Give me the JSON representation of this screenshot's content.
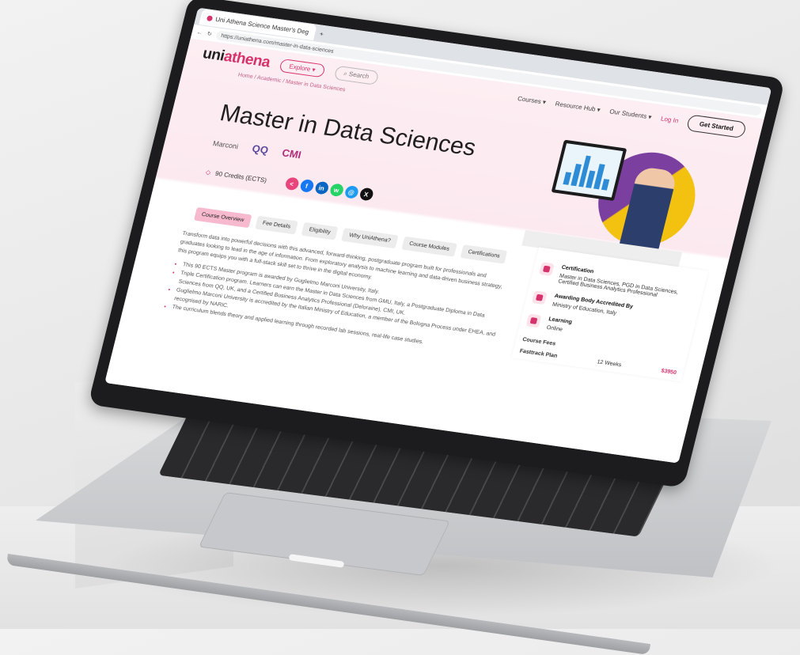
{
  "browser": {
    "tab_title": "Uni Athena Science Master's Deg",
    "url": "https://uniathena.com/master-in-data-sciences"
  },
  "nav": {
    "logo_main": "uni",
    "logo_accent": "athena",
    "explore": "Explore ▾",
    "search": "Search",
    "courses": "Courses ▾",
    "resource_hub": "Resource Hub ▾",
    "our_students": "Our Students ▾",
    "login": "Log In",
    "get_started": "Get Started"
  },
  "breadcrumb": "Home / Academic / Master in Data Sciences",
  "hero": {
    "title": "Master in Data Sciences",
    "logo_a": "Marconi",
    "logo_b": "QQ",
    "logo_c": "CMI",
    "credits": "90 Credits (ECTS)"
  },
  "share_icons": [
    {
      "name": "share-icon",
      "glyph": "<",
      "color": "#e8457c"
    },
    {
      "name": "facebook-icon",
      "glyph": "f",
      "color": "#1877f2"
    },
    {
      "name": "linkedin-icon",
      "glyph": "in",
      "color": "#0a66c2"
    },
    {
      "name": "whatsapp-icon",
      "glyph": "w",
      "color": "#25d366"
    },
    {
      "name": "email-icon",
      "glyph": "@",
      "color": "#1d9bf0"
    },
    {
      "name": "x-icon",
      "glyph": "X",
      "color": "#111111"
    }
  ],
  "course_tabs": [
    "Course Overview",
    "Fee Details",
    "Eligibility",
    "Why UniAthena?",
    "Course Modules",
    "Certifications"
  ],
  "overview": {
    "intro": "Transform data into powerful decisions with this advanced, forward-thinking, postgraduate program built for professionals and graduates looking to lead in the age of information. From exploratory analysis to machine learning and data-driven business strategy, this program equips you with a full-stack skill set to thrive in the digital economy.",
    "bullets": [
      "This 90 ECTS Master program is awarded by Guglielmo Marconi University, Italy.",
      "Triple Certification program. Learners can earn the Master in Data Sciences from GMU, Italy, a Postgraduate Diploma in Data Sciences from QQ, UK, and a Certified Business Analytics Professional (Deloraine), CMI, UK.",
      "Guglielmo Marconi University is accredited by the Italian Ministry of Education, a member of the Bologna Process under EHEA, and recognised by NARIC.",
      "The curriculum blends theory and applied learning through recorded lab sessions, real-life case studies."
    ]
  },
  "sidebar": {
    "certification_head": "Certification",
    "certification_text": "Master in Data Sciences, PGD in Data Sciences, Certified Business Analytics Professional",
    "awarding_head": "Awarding Body Accredited By",
    "awarding_text": "Ministry of Education, Italy",
    "learning_head": "Learning",
    "learning_text": "Online",
    "fees_head": "Course Fees",
    "plan_label": "Fasttrack Plan",
    "plan_duration": "12 Weeks",
    "plan_price": "$3950"
  }
}
